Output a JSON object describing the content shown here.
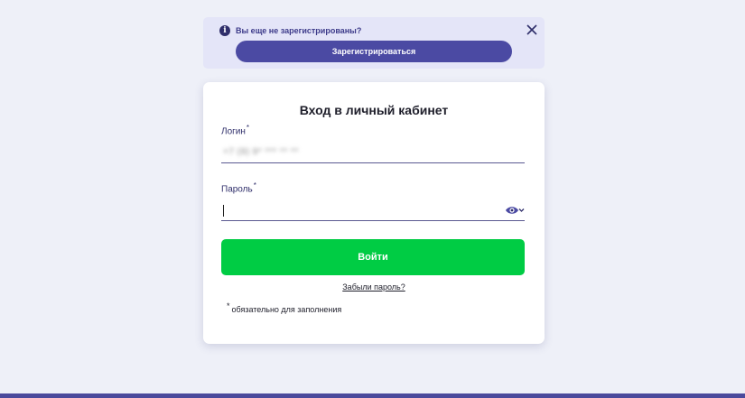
{
  "notice": {
    "text": "Вы еще не зарегистрированы?",
    "register_label": "Зарегистрироваться"
  },
  "login_form": {
    "title": "Вход в личный кабинет",
    "login_label": "Логин",
    "login_value": "+7 (9) 9* *** ** **",
    "password_label": "Пароль",
    "required_mark": "*",
    "submit_label": "Войти",
    "forgot_label": "Забыли пароль?",
    "required_note": "обязательно для заполнения"
  },
  "colors": {
    "background": "#eef0f8",
    "accent": "#4b4aa3",
    "notice_bg": "#e4e5f8",
    "submit": "#00cc44",
    "footer_bar": "#4b4a9c"
  },
  "icons": {
    "info": "info-icon",
    "close": "close-icon",
    "password_toggle": "eye-icon"
  }
}
